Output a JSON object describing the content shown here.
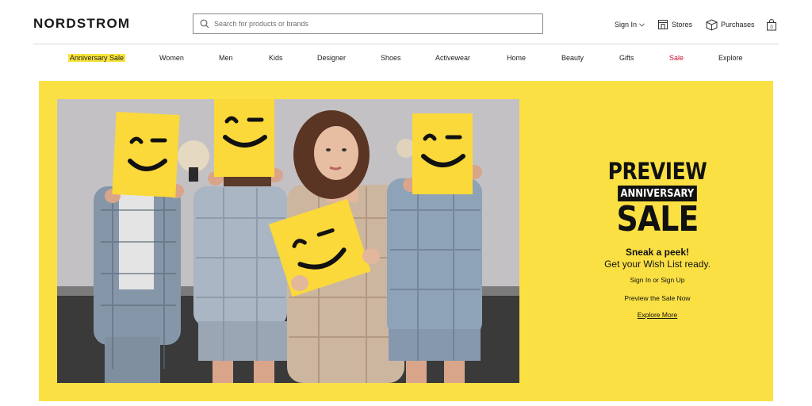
{
  "brand": {
    "logo": "NORDSTROM"
  },
  "search": {
    "placeholder": "Search for products or brands"
  },
  "utility": {
    "sign_in": "Sign In",
    "stores": "Stores",
    "purchases": "Purchases"
  },
  "nav": {
    "items": [
      {
        "label": "Anniversary Sale"
      },
      {
        "label": "Women"
      },
      {
        "label": "Men"
      },
      {
        "label": "Kids"
      },
      {
        "label": "Designer"
      },
      {
        "label": "Shoes"
      },
      {
        "label": "Activewear"
      },
      {
        "label": "Home"
      },
      {
        "label": "Beauty"
      },
      {
        "label": "Gifts"
      },
      {
        "label": "Sale"
      },
      {
        "label": "Explore"
      }
    ]
  },
  "hero": {
    "headline_1": "PREVIEW",
    "headline_2": "ANNIVERSARY",
    "headline_3": "SALE",
    "sneak": "Sneak a peek!",
    "subtitle": "Get your Wish List ready.",
    "link_sign": "Sign In or Sign Up",
    "link_preview": "Preview the Sale Now",
    "link_explore": "Explore More"
  },
  "colors": {
    "hero_yellow": "#fbe044",
    "highlight": "#f8e43a",
    "sale_red": "#c8102e"
  }
}
